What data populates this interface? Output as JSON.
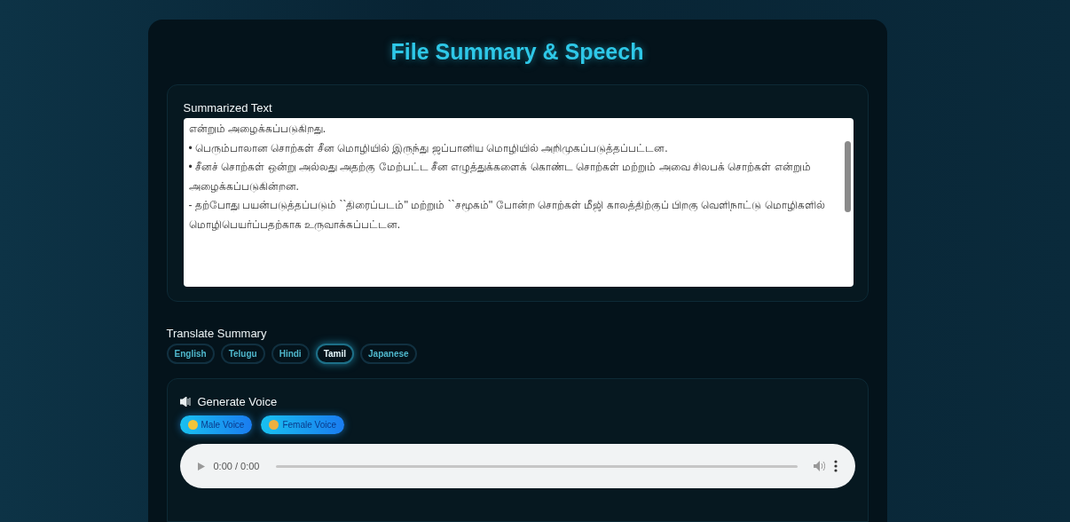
{
  "title": "File Summary & Speech",
  "summary": {
    "label": "Summarized Text",
    "lines": [
      "என்றும் அழைக்கப்படுகிறது.",
      "• பெரும்பாலான சொற்கள் சீன மொழியில் இருந்து ஜப்பானிய மொழியில் அறிமுகப்படுத்தப்பட்டன.",
      "• சீனச் சொற்கள் ஒன்று அல்லது அதற்கு மேற்பட்ட சீன எழுத்துக்களைக் கொண்ட சொற்கள் மற்றும் அவை சிலபக் சொற்கள் என்றும் அழைக்கப்படுகின்றன.",
      "- தற்போது பயன்படுத்தப்படும் ``திரைப்படம்'' மற்றும் ``சமூகம்'' போன்ற சொற்கள் மீஜி காலத்திற்குப் பிறகு வெளிநாட்டு மொழிகளில் மொழிபெயர்ப்பதற்காக உருவாக்கப்பட்டன."
    ]
  },
  "translate": {
    "label": "Translate Summary",
    "languages": [
      {
        "label": "English",
        "selected": false
      },
      {
        "label": "Telugu",
        "selected": false
      },
      {
        "label": "Hindi",
        "selected": false
      },
      {
        "label": "Tamil",
        "selected": true
      },
      {
        "label": "Japanese",
        "selected": false
      }
    ]
  },
  "voice": {
    "label": "Generate Voice",
    "buttons": [
      {
        "label": "Male Voice",
        "kind": "male"
      },
      {
        "label": "Female Voice",
        "kind": "female"
      }
    ],
    "player": {
      "time": "0:00 / 0:00"
    }
  }
}
